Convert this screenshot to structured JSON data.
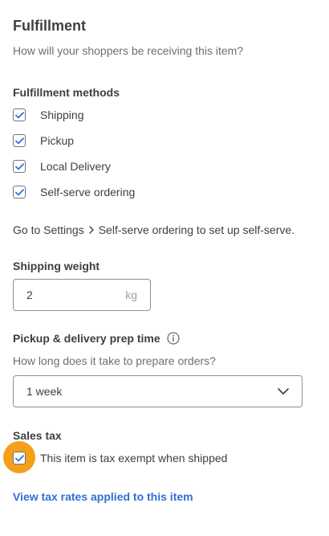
{
  "header": {
    "title": "Fulfillment",
    "subtitle": "How will your shoppers be receiving this item?"
  },
  "fulfillment_methods": {
    "label": "Fulfillment methods",
    "items": [
      {
        "label": "Shipping",
        "checked": true
      },
      {
        "label": "Pickup",
        "checked": true
      },
      {
        "label": "Local Delivery",
        "checked": true
      },
      {
        "label": "Self-serve ordering",
        "checked": true
      }
    ]
  },
  "settings_hint": {
    "prefix": "Go to Settings",
    "suffix": "Self-serve ordering to set up self-serve."
  },
  "shipping_weight": {
    "label": "Shipping weight",
    "value": "2",
    "unit": "kg"
  },
  "prep_time": {
    "label": "Pickup & delivery prep time",
    "help": "How long does it take to prepare orders?",
    "selected": "1 week"
  },
  "sales_tax": {
    "label": "Sales tax",
    "exempt_label": "This item is tax exempt when shipped",
    "exempt_checked": true,
    "link": "View tax rates applied to this item"
  },
  "colors": {
    "accent": "#2f6fd6",
    "highlight": "#f5a01a",
    "text": "#3c3f43",
    "muted": "#6b6f74"
  }
}
